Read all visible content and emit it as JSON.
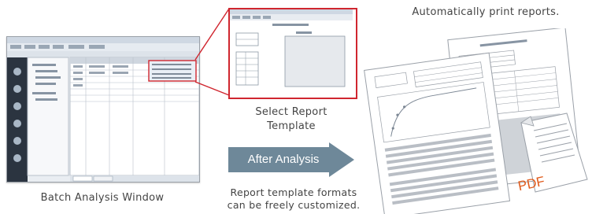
{
  "labels": {
    "auto_print": "Automatically print reports.",
    "select_template": "Select Report\nTemplate",
    "after_analysis": "After Analysis",
    "batch_window": "Batch Analysis Window",
    "customize": "Report template formats\ncan be freely customized.",
    "pdf": "PDF"
  },
  "colors": {
    "highlight": "#d0262f",
    "arrow": "#6e8899",
    "pdf_text": "#e05a1a"
  }
}
